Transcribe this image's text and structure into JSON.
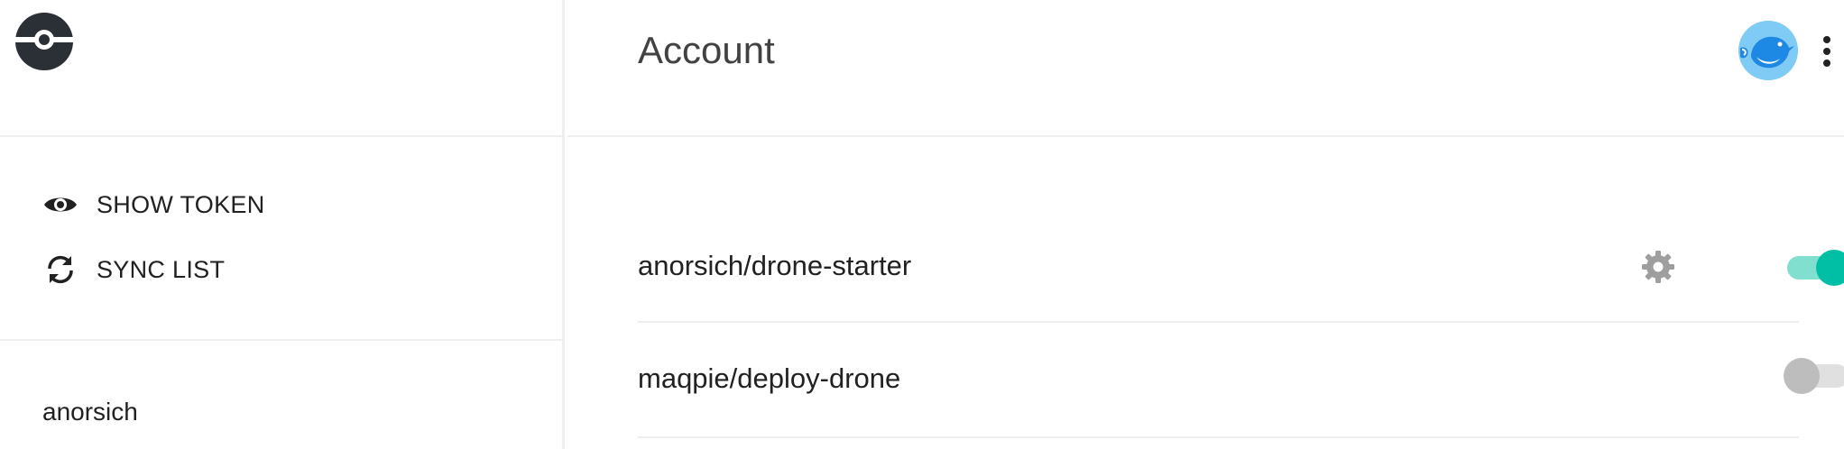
{
  "app": {
    "logo": "drone-logo",
    "page_title": "Account"
  },
  "sidebar": {
    "actions": [
      {
        "label": "SHOW TOKEN",
        "icon": "eye-icon"
      },
      {
        "label": "SYNC LIST",
        "icon": "sync-icon"
      }
    ],
    "account": {
      "name": "anorsich"
    }
  },
  "header": {
    "avatar": "bird-avatar",
    "menu_icon": "kebab-menu-icon"
  },
  "repos": [
    {
      "name": "anorsich/drone-starter",
      "active": true,
      "has_settings": true
    },
    {
      "name": "maqpie/deploy-drone",
      "active": false,
      "has_settings": false
    }
  ],
  "colors": {
    "accent": "#00bfa5",
    "accent_light": "#80dfcf",
    "toggle_off": "#bdbdbd",
    "logo": "#2b2f36",
    "avatar_bg": "#80cbf5"
  }
}
